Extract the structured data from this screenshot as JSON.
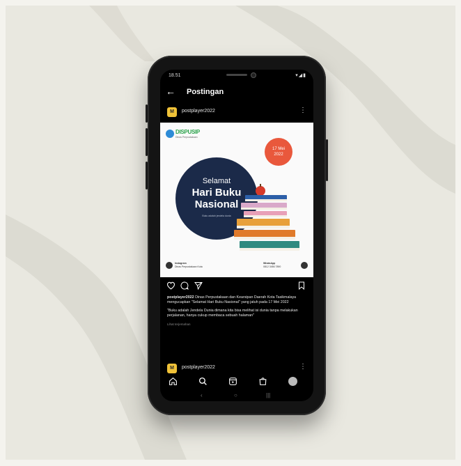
{
  "status_bar": {
    "time": "18.51",
    "icons": "▾◢▮"
  },
  "topbar": {
    "back_icon": "arrow-left-icon",
    "title": "Postingan"
  },
  "post": {
    "avatar_text": "M",
    "username": "postplayer2022",
    "more_icon": "more-vertical-icon",
    "image": {
      "logo_text": "DISPUSIP",
      "logo_sub": "Dinas Perpustakaan",
      "date_badge": "17 Mei 2022",
      "line1": "Selamat",
      "line2": "Hari Buku",
      "line3": "Nasional",
      "tagline": "Buku adalah jendela dunia",
      "footer_left_1": "Instagram",
      "footer_left_2": "Dinas Perpustakaan Kota",
      "footer_right_1": "WhatsApp",
      "footer_right_2": "0812 3456 7890"
    },
    "caption_user": "postplayer2022",
    "caption_1": "Dinas Perpustakaan dan Kearsipan Daerah Kota Tasikmalaya mengucapkan \"Selamat Hari Buku Nasional\" yang jatuh pada 17 Mei 2022",
    "caption_2": "\"Buku adalah Jendela Dunia dimana kita bisa melihat isi dunia tanpa melakukan perjalanan, hanya cukup membaca sebuah halaman\"",
    "translate": "Lihat terjemahan"
  },
  "next_post": {
    "avatar_text": "M",
    "username": "postplayer2022"
  },
  "bottom_nav": [
    "home-icon",
    "search-icon",
    "reels-icon",
    "shop-icon",
    "profile-icon"
  ],
  "system_nav": {
    "back": "‹",
    "home": "○",
    "recent": "|||"
  },
  "colors": {
    "accent_orange": "#e9583c",
    "navy": "#1b2a49",
    "background": "#e9e8e0"
  }
}
